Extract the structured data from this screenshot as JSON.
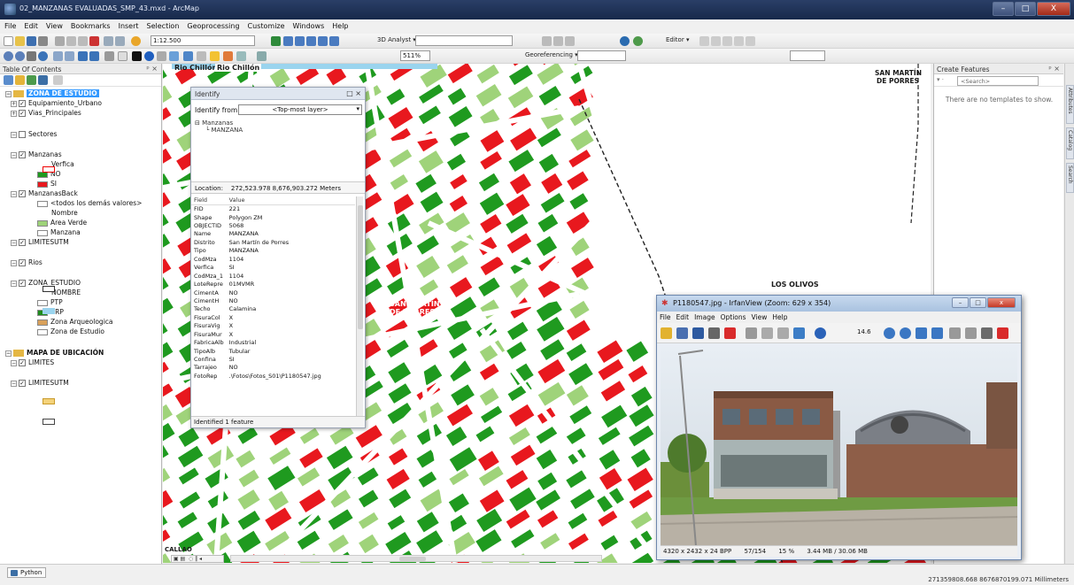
{
  "window": {
    "title": "02_MANZANAS EVALUADAS_SMP_43.mxd - ArcMap",
    "min": "–",
    "max": "□",
    "close": "X"
  },
  "menu": [
    "File",
    "Edit",
    "View",
    "Bookmarks",
    "Insert",
    "Selection",
    "Geoprocessing",
    "Customize",
    "Windows",
    "Help"
  ],
  "toolbar": {
    "scale": "1:12.500",
    "analyst": "3D Analyst ▾",
    "zoom_pct": "511%",
    "georef": "Georeferencing ▾",
    "editor": "Editor ▾"
  },
  "toc": {
    "title": "Table Of Contents",
    "close": "ᵖ ×",
    "items": [
      {
        "label": "ZONA DE ESTUDIO",
        "level": 0,
        "kind": "group"
      },
      {
        "label": "Equipamiento_Urbano",
        "level": 1,
        "kind": "layer"
      },
      {
        "label": "Vias_Principales",
        "level": 1,
        "kind": "layer"
      },
      {
        "label": "Sectores",
        "level": 1,
        "kind": "layer"
      },
      {
        "label": "Manzanas",
        "level": 1,
        "kind": "layer"
      },
      {
        "label": "Verfica",
        "level": 3,
        "kind": "text"
      },
      {
        "label": "NO",
        "level": 2,
        "kind": "legend"
      },
      {
        "label": "SI",
        "level": 2,
        "kind": "legend"
      },
      {
        "label": "ManzanasBack",
        "level": 1,
        "kind": "layer"
      },
      {
        "label": "<todos los demás valores>",
        "level": 2,
        "kind": "legend"
      },
      {
        "label": "Nombre",
        "level": 3,
        "kind": "text"
      },
      {
        "label": "Area Verde",
        "level": 2,
        "kind": "legend"
      },
      {
        "label": "Manzana",
        "level": 2,
        "kind": "legend"
      },
      {
        "label": "LIMITESUTM",
        "level": 1,
        "kind": "layer"
      },
      {
        "label": "Rios",
        "level": 1,
        "kind": "layer"
      },
      {
        "label": "ZONA_ESTUDIO",
        "level": 1,
        "kind": "layer"
      },
      {
        "label": "NOMBRE",
        "level": 3,
        "kind": "text"
      },
      {
        "label": "PTP",
        "level": 2,
        "kind": "legend"
      },
      {
        "label": "ZRP",
        "level": 2,
        "kind": "legend"
      },
      {
        "label": "Zona Arqueologica",
        "level": 2,
        "kind": "legend"
      },
      {
        "label": "Zona de Estudio",
        "level": 2,
        "kind": "legend"
      },
      {
        "label": "MAPA DE UBICACIÓN",
        "level": 0,
        "kind": "group"
      },
      {
        "label": "LIMITES",
        "level": 1,
        "kind": "layer"
      },
      {
        "label": "LIMITESUTM",
        "level": 1,
        "kind": "layer"
      }
    ]
  },
  "map": {
    "labels": {
      "rio1": "Rio Chillón",
      "rio2": "Rio Chillón",
      "smp_top": "SAN MARTÍN",
      "smp_top2": "DE PORRES",
      "los_olivos": "LOS OLIVOS",
      "smp_mid": "SAN MARTÍN",
      "smp_mid2": "DE PORRES",
      "callao": "CALLAO"
    },
    "colors": {
      "verifica_no": "#1f9a1f",
      "verifica_si": "#e8181e",
      "area_verde": "#9fd37a"
    }
  },
  "identify": {
    "title": "Identify",
    "from_label": "Identify from:",
    "from_value": "<Top-most layer>",
    "tree_root": "Manzanas",
    "tree_child": "MANZANA",
    "location_label": "Location:",
    "location_value": "272,523.978  8,676,903.272 Meters",
    "col_field": "Field",
    "col_value": "Value",
    "rows": [
      [
        "FID",
        "221"
      ],
      [
        "Shape",
        "Polygon ZM"
      ],
      [
        "OBJECTID",
        "5068"
      ],
      [
        "Name",
        "MANZANA"
      ],
      [
        "Distrito",
        "San Martín de Porres"
      ],
      [
        "Tipo",
        "MANZANA"
      ],
      [
        "CodMza",
        "1104"
      ],
      [
        "Verfica",
        "SI"
      ],
      [
        "CodMza_1",
        "1104"
      ],
      [
        "LoteRepre",
        "01MVMR"
      ],
      [
        "CimentA",
        "NO"
      ],
      [
        "CimentH",
        "NO"
      ],
      [
        "Techo",
        "Calamina"
      ],
      [
        "FisuraCol",
        "X"
      ],
      [
        "FisuraVig",
        "X"
      ],
      [
        "FisuraMur",
        "X"
      ],
      [
        "FabricaAlb",
        "Industrial"
      ],
      [
        "TipoAlb",
        "Tubular"
      ],
      [
        "Confina",
        "SI"
      ],
      [
        "Tarrajeo",
        "NO"
      ],
      [
        "FotoRep",
        ".\\Fotos\\Fotos_S01\\P1180547.jpg"
      ]
    ],
    "footer": "Identified 1 feature"
  },
  "create_features": {
    "title": "Create Features",
    "search": "<Search>",
    "message": "There are no templates to show."
  },
  "side_tabs": [
    "Attributes",
    "Catalog",
    "Search"
  ],
  "irfan": {
    "title": "P1180547.jpg - IrfanView (Zoom: 629 x 354)",
    "menu": [
      "File",
      "Edit",
      "Image",
      "Options",
      "View",
      "Help"
    ],
    "zoom": "14.6",
    "status": [
      "4320 x 2432 x 24 BPP",
      "57/154",
      "15 %",
      "3.44 MB / 30.06 MB"
    ]
  },
  "status": {
    "python": "Python",
    "coords": "271359808.668  8676870199.071 Millimeters"
  }
}
